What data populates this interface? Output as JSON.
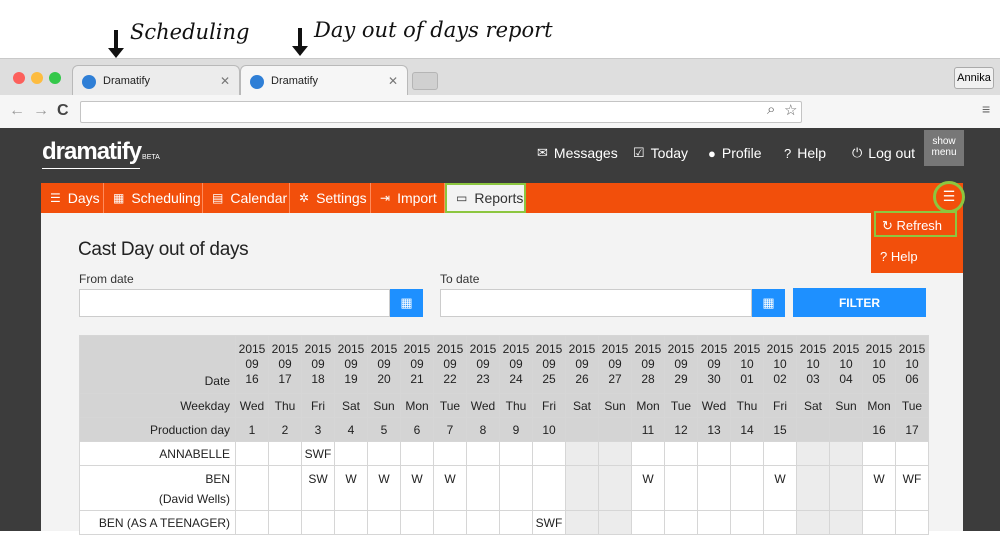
{
  "annotations": {
    "scheduling": "Scheduling",
    "report": "Day out of days report"
  },
  "browser": {
    "tabs": [
      {
        "label": "Dramatify"
      },
      {
        "label": "Dramatify"
      }
    ],
    "user_button": "Annika"
  },
  "app": {
    "logo": "dramatify",
    "logo_badge": "BETA",
    "topnav": {
      "messages": "Messages",
      "today": "Today",
      "profile": "Profile",
      "help": "Help",
      "logout": "Log out"
    },
    "show_menu": [
      "show",
      "menu"
    ],
    "tabs": {
      "days": "Days",
      "scheduling": "Scheduling",
      "calendar": "Calendar",
      "settings": "Settings",
      "import": "Import",
      "reports": "Reports"
    },
    "menu": {
      "refresh": "Refresh",
      "help": "Help"
    }
  },
  "report": {
    "title": "Cast Day out of days",
    "from_label": "From date",
    "to_label": "To date",
    "filter_label": "FILTER",
    "headers": {
      "date": "Date",
      "weekday": "Weekday",
      "production_day": "Production day"
    },
    "columns": [
      {
        "year": "2015",
        "month": "09",
        "day": "16",
        "weekday": "Wed",
        "prod": "1",
        "weekend": false
      },
      {
        "year": "2015",
        "month": "09",
        "day": "17",
        "weekday": "Thu",
        "prod": "2",
        "weekend": false
      },
      {
        "year": "2015",
        "month": "09",
        "day": "18",
        "weekday": "Fri",
        "prod": "3",
        "weekend": false
      },
      {
        "year": "2015",
        "month": "09",
        "day": "19",
        "weekday": "Sat",
        "prod": "4",
        "weekend": false
      },
      {
        "year": "2015",
        "month": "09",
        "day": "20",
        "weekday": "Sun",
        "prod": "5",
        "weekend": false
      },
      {
        "year": "2015",
        "month": "09",
        "day": "21",
        "weekday": "Mon",
        "prod": "6",
        "weekend": false
      },
      {
        "year": "2015",
        "month": "09",
        "day": "22",
        "weekday": "Tue",
        "prod": "7",
        "weekend": false
      },
      {
        "year": "2015",
        "month": "09",
        "day": "23",
        "weekday": "Wed",
        "prod": "8",
        "weekend": false
      },
      {
        "year": "2015",
        "month": "09",
        "day": "24",
        "weekday": "Thu",
        "prod": "9",
        "weekend": false
      },
      {
        "year": "2015",
        "month": "09",
        "day": "25",
        "weekday": "Fri",
        "prod": "10",
        "weekend": false
      },
      {
        "year": "2015",
        "month": "09",
        "day": "26",
        "weekday": "Sat",
        "prod": "",
        "weekend": true
      },
      {
        "year": "2015",
        "month": "09",
        "day": "27",
        "weekday": "Sun",
        "prod": "",
        "weekend": true
      },
      {
        "year": "2015",
        "month": "09",
        "day": "28",
        "weekday": "Mon",
        "prod": "11",
        "weekend": false
      },
      {
        "year": "2015",
        "month": "09",
        "day": "29",
        "weekday": "Tue",
        "prod": "12",
        "weekend": false
      },
      {
        "year": "2015",
        "month": "09",
        "day": "30",
        "weekday": "Wed",
        "prod": "13",
        "weekend": false
      },
      {
        "year": "2015",
        "month": "10",
        "day": "01",
        "weekday": "Thu",
        "prod": "14",
        "weekend": false
      },
      {
        "year": "2015",
        "month": "10",
        "day": "02",
        "weekday": "Fri",
        "prod": "15",
        "weekend": false
      },
      {
        "year": "2015",
        "month": "10",
        "day": "03",
        "weekday": "Sat",
        "prod": "",
        "weekend": true
      },
      {
        "year": "2015",
        "month": "10",
        "day": "04",
        "weekday": "Sun",
        "prod": "",
        "weekend": true
      },
      {
        "year": "2015",
        "month": "10",
        "day": "05",
        "weekday": "Mon",
        "prod": "16",
        "weekend": false
      },
      {
        "year": "2015",
        "month": "10",
        "day": "06",
        "weekday": "Tue",
        "prod": "17",
        "weekend": false
      }
    ],
    "cast": [
      {
        "name": "ANNABELLE",
        "actor": "",
        "cells": [
          "",
          "",
          "SWF",
          "",
          "",
          "",
          "",
          "",
          "",
          "",
          "",
          "",
          "",
          "",
          "",
          "",
          "",
          "",
          "",
          "",
          ""
        ]
      },
      {
        "name": "BEN",
        "actor": "(David Wells)",
        "cells": [
          "",
          "",
          "SW",
          "W",
          "W",
          "W",
          "W",
          "",
          "",
          "",
          "",
          "",
          "W",
          "",
          "",
          "",
          "W",
          "",
          "",
          "W",
          "WF"
        ]
      },
      {
        "name": "BEN (AS A TEENAGER)",
        "actor": "",
        "cells": [
          "",
          "",
          "",
          "",
          "",
          "",
          "",
          "",
          "",
          "SWF",
          "",
          "",
          "",
          "",
          "",
          "",
          "",
          "",
          "",
          "",
          ""
        ]
      }
    ]
  }
}
